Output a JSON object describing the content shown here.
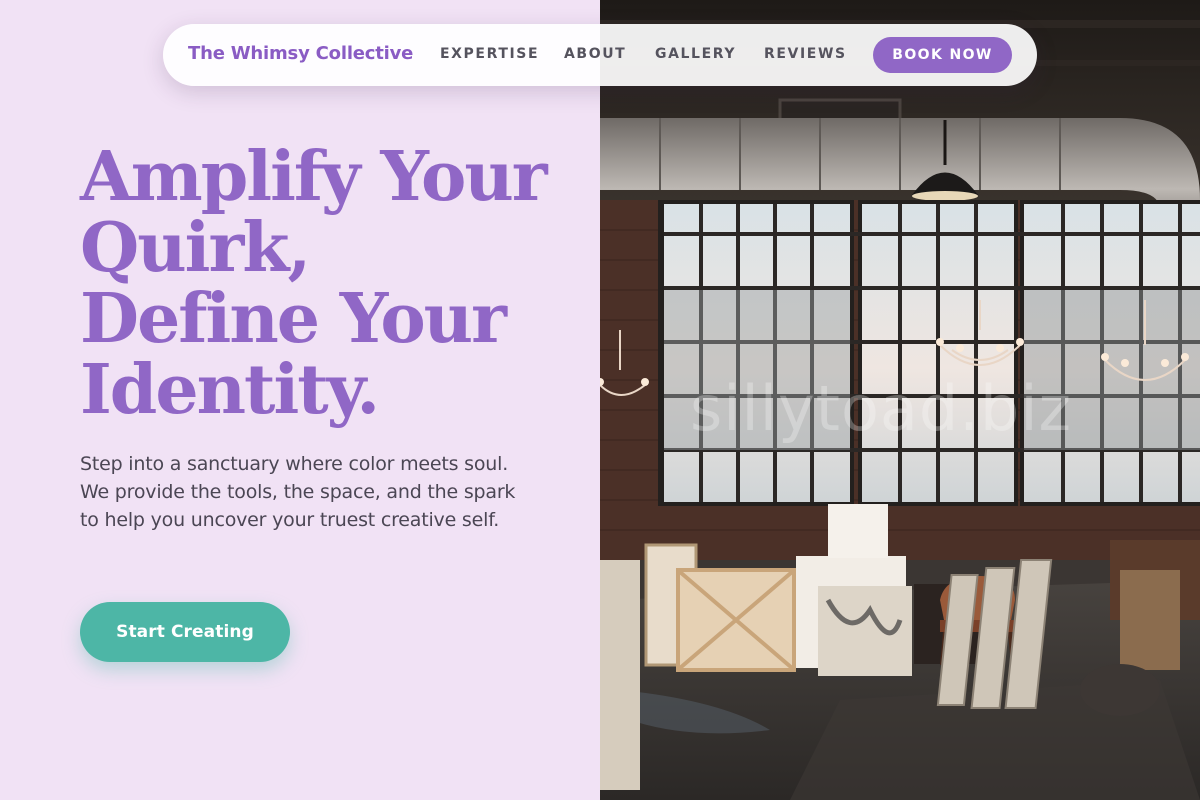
{
  "nav": {
    "brand": "The Whimsy Collective",
    "links": [
      "EXPERTISE",
      "ABOUT",
      "GALLERY",
      "REVIEWS"
    ],
    "cta": "BOOK NOW"
  },
  "hero": {
    "title_lines": [
      "Amplify Your",
      "Quirk,",
      "Define Your",
      "Identity."
    ],
    "description": "Step into a sanctuary where color meets soul. We provide the tools, the space, and the spark to help you uncover your truest creative self.",
    "cta": "Start Creating"
  },
  "image": {
    "watermark": "sillytoad.biz",
    "subject": "industrial-art-studio-photo"
  },
  "colors": {
    "accent_purple": "#9067c6",
    "teal": "#4db6a6",
    "background": "#f1e2f5"
  }
}
